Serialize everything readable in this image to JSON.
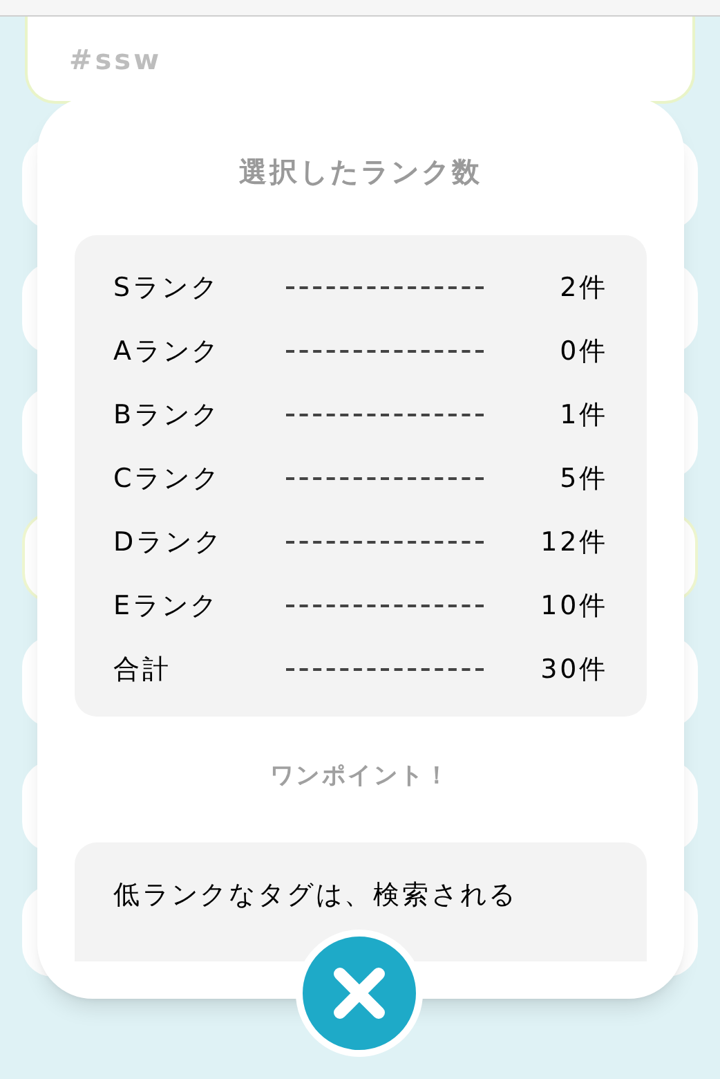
{
  "background": {
    "tag": "#ssw"
  },
  "modal": {
    "title": "選択したランク数",
    "ranks": [
      {
        "label": "Sランク",
        "count": "2件"
      },
      {
        "label": "Aランク",
        "count": "0件"
      },
      {
        "label": "Bランク",
        "count": "1件"
      },
      {
        "label": "Cランク",
        "count": "5件"
      },
      {
        "label": "Dランク",
        "count": "12件"
      },
      {
        "label": "Eランク",
        "count": "10件"
      },
      {
        "label": "合計",
        "count": "30件"
      }
    ],
    "tip_heading": "ワンポイント！",
    "tip_text": "低ランクなタグは、検索される"
  }
}
